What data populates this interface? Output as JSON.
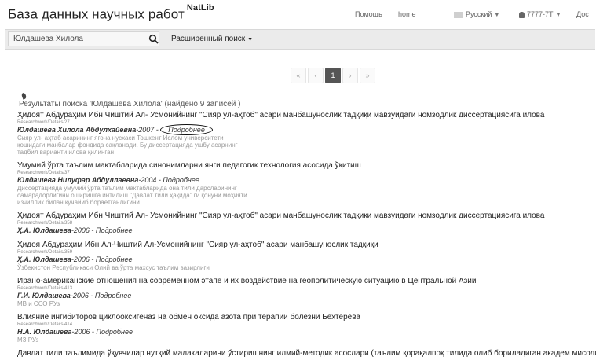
{
  "header": {
    "brand": "База данных научных работ",
    "brand_sup": "NatLib",
    "nav_help": "Помощь",
    "nav_home": "home",
    "nav_lang": "Русский",
    "nav_user": "7777-7Т",
    "nav_doc": "Дос"
  },
  "search": {
    "query": "Юлдашева Хилола",
    "advanced_label": "Расширенный поиск"
  },
  "pagination": {
    "first": "«",
    "prev": "‹",
    "current": "1",
    "next": "›",
    "last": "»"
  },
  "summary": "Результаты поиска 'Юлдашева Хилола' (найдено 9 записей )",
  "more_label": "Подробнее",
  "results": [
    {
      "title": "Ҳидоят Абдураҳим Ибн Чиштий Ал- Усмонийнинг \"Сияр ул-аҳтоб\" асари манбашунослик тадқиқи мавзуидаги номзодлик диссертациясига илова",
      "path": "Researchwork/Details/27",
      "authors": "Юлдашева Хилола Абдулхайевна",
      "year": "2007",
      "desc": "Сияр ул- аҳтаб асарининг ягона нусхаси Тошкент Ислом университети қошидаги манбалар фондида сақланади. Бу диссертацияда ушбу асарнинг тадбил варианти илова қилинган"
    },
    {
      "title": "Умумий ўрта таълим мактабларида синонимларни янги педагогик технология асосида ўқитиш",
      "path": "Researchwork/Details/37",
      "authors": "Юлдашева Нилуфар Абдуллаевна",
      "year": "2004",
      "desc": "Диссертацияда умумий ўрта таълим мактабларида она тили дарсларининг самарадорлигини оширишга интилиш \"Давлат тили ҳақида\" ги қонуни моҳияти изчиллик билан кучайиб бораётганлигини"
    },
    {
      "title": "Ҳидоят Абдураҳим Ибн Чиштий Ал- Усмонийнинг \"Сияр ул-аҳтоб\" асари манбашунослик тадқики мавзуидаги номзодлик диссертациясига илова",
      "path": "Researchwork/Details/358",
      "authors": "Ҳ.А. Юлдашева",
      "year": "2006",
      "desc": ""
    },
    {
      "title": "Ҳидоя Абдураҳим Ибн Ал-Чиштий Ал-Усмонийнинг \"Сияр ул-аҳтоб\" асари манбашунослик тадқиқи",
      "path": "Researchwork/Details/359",
      "authors": "Ҳ.А. Юлдашева",
      "year": "2006",
      "desc": "Ўзбекистон Республикаси Олий ва ўрта махсус таълим вазирлиги"
    },
    {
      "title": "Ирано-американские отношения на современном этапе и их воздействие на геополитическую ситуацию в Центральной Азии",
      "path": "Researchwork/Details/413",
      "authors": "Г.И. Юлдашева",
      "year": "2006",
      "desc": "МВ и ССО РУз"
    },
    {
      "title": "Влияние ингибиторов циклооксигеназ на обмен оксида азота при терапии болезни Бехтерева",
      "path": "Researchwork/Details/414",
      "authors": "Н.А. Юлдашева",
      "year": "2006",
      "desc": "МЗ РУз"
    },
    {
      "title": "Давлат тили таълимида ўқувчилар нутқий малакаларини ўстиришнинг илмий-методик асослари (таълим қорақалпоқ тилида олиб бориладиган академ мисолида)",
      "path": "",
      "authors": "",
      "year": "",
      "desc": ""
    }
  ]
}
